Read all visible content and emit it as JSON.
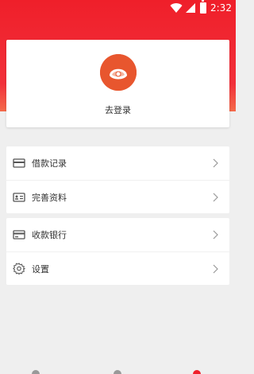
{
  "status_bar": {
    "time": "2:32"
  },
  "profile": {
    "login_label": "去登录"
  },
  "menu": {
    "group1": [
      {
        "label": "借款记录",
        "icon": "wallet-icon"
      },
      {
        "label": "完善资料",
        "icon": "id-card-icon"
      }
    ],
    "group2": [
      {
        "label": "收款银行",
        "icon": "bank-card-icon"
      },
      {
        "label": "设置",
        "icon": "gear-icon"
      }
    ]
  },
  "colors": {
    "brand_red": "#ef1f2a",
    "avatar": "#e8562e"
  }
}
